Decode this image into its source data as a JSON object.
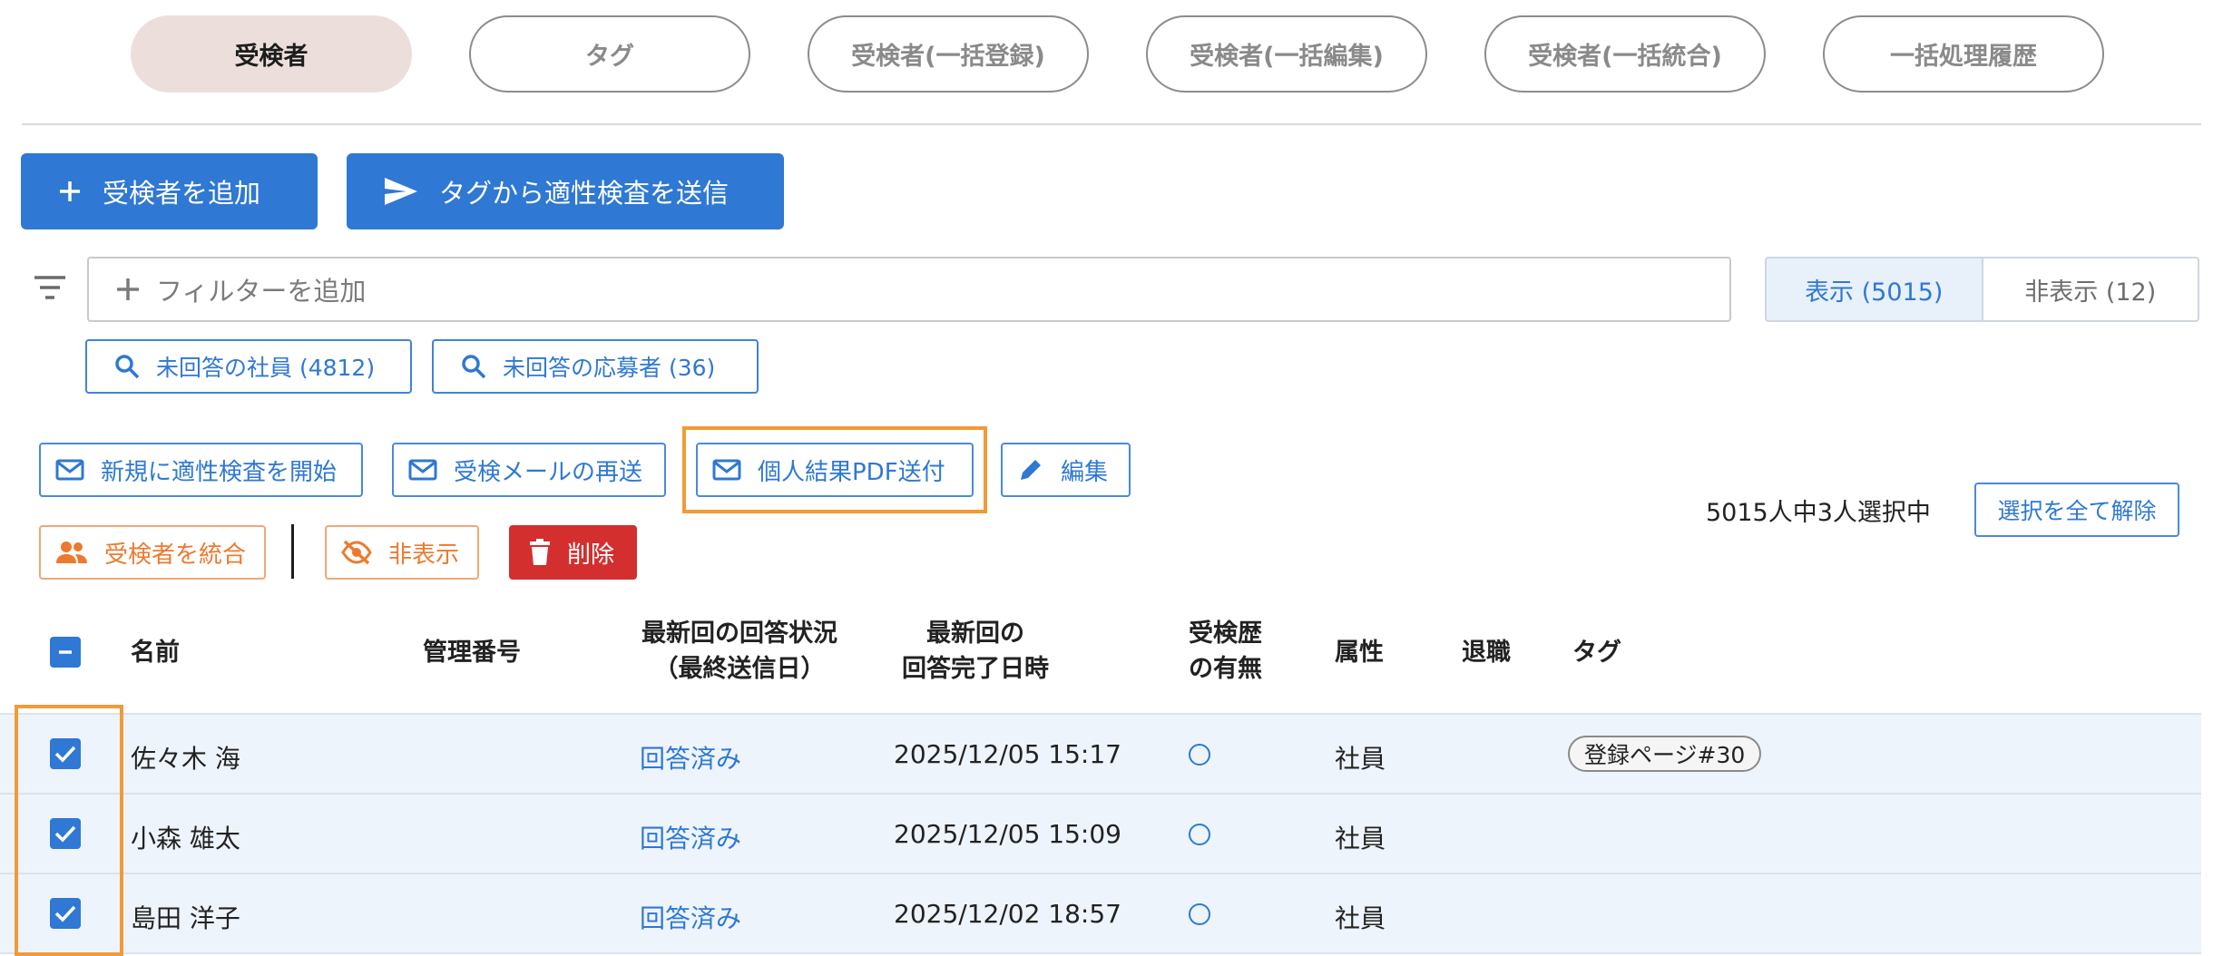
{
  "tabs": [
    {
      "label": "受検者",
      "active": true
    },
    {
      "label": "タグ",
      "active": false
    },
    {
      "label": "受検者(一括登録)",
      "active": false
    },
    {
      "label": "受検者(一括編集)",
      "active": false
    },
    {
      "label": "受検者(一括統合)",
      "active": false
    },
    {
      "label": "一括処理履歴",
      "active": false
    }
  ],
  "primary_actions": {
    "add_examinee": "受検者を追加",
    "send_from_tag": "タグから適性検査を送信"
  },
  "filter": {
    "add_filter": "フィルターを追加"
  },
  "visibility_toggle": {
    "shown": "表示 (5015)",
    "hidden": "非表示 (12)"
  },
  "quick_filters": [
    {
      "label": "未回答の社員 (4812)"
    },
    {
      "label": "未回答の応募者 (36)"
    }
  ],
  "bulk_actions": {
    "start_new": "新規に適性検査を開始",
    "resend_mail": "受検メールの再送",
    "send_pdf": "個人結果PDF送付",
    "edit": "編集",
    "merge": "受検者を統合",
    "hide": "非表示",
    "delete": "削除"
  },
  "selection": {
    "summary": "5015人中3人選択中",
    "clear_all": "選択を全て解除"
  },
  "table": {
    "headers": {
      "name": "名前",
      "mgmt_no": "管理番号",
      "status_l1": "最新回の回答状況",
      "status_l2": "（最終送信日）",
      "completed_l1": "最新回の",
      "completed_l2": "回答完了日時",
      "history_l1": "受検歴",
      "history_l2": "の有無",
      "attribute": "属性",
      "retired": "退職",
      "tags": "タグ"
    },
    "rows": [
      {
        "name": "佐々木 海",
        "status": "回答済み",
        "completed": "2025/12/05 15:17",
        "history": "○",
        "attribute": "社員",
        "tag": "登録ページ#30",
        "checked": true
      },
      {
        "name": "小森 雄太",
        "status": "回答済み",
        "completed": "2025/12/05 15:09",
        "history": "○",
        "attribute": "社員",
        "tag": "",
        "checked": true
      },
      {
        "name": "島田 洋子",
        "status": "回答済み",
        "completed": "2025/12/02 18:57",
        "history": "○",
        "attribute": "社員",
        "tag": "",
        "checked": true
      }
    ]
  },
  "colors": {
    "primary": "#2f78d3",
    "danger": "#d32f2f",
    "warning": "#ec7a2e",
    "highlight": "#f19a38",
    "active_tab": "#ecdfdb",
    "selected_row": "#eef4fb"
  }
}
